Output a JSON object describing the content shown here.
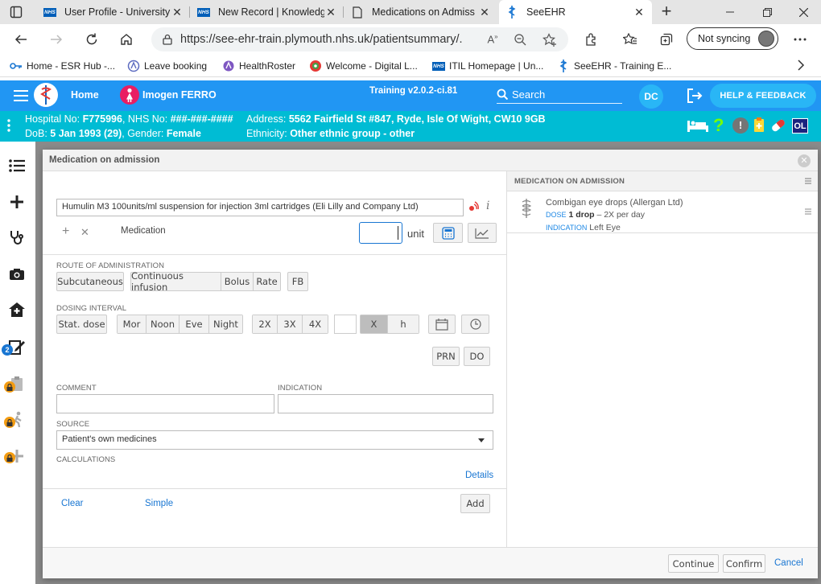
{
  "browser": {
    "tabs": [
      {
        "title": "User Profile - University",
        "icon": "nhs-icon"
      },
      {
        "title": "New Record | Knowledg",
        "icon": "nhs-icon"
      },
      {
        "title": "Medications on Admiss",
        "icon": "document-icon"
      },
      {
        "title": "SeeEHR",
        "icon": "seeehr-icon",
        "active": true
      }
    ],
    "url": "https://see-ehr-train.plymouth.nhs.uk/patientsummary/...",
    "sync_label": "Not syncing",
    "bookmarks": [
      {
        "label": "Home - ESR Hub -...",
        "icon": "key-icon"
      },
      {
        "label": "Leave booking",
        "icon": "roster-icon"
      },
      {
        "label": "HealthRoster",
        "icon": "roster-icon"
      },
      {
        "label": "Welcome - Digital L...",
        "icon": "globe-icon"
      },
      {
        "label": "ITIL Homepage | Un...",
        "icon": "nhs-icon"
      },
      {
        "label": "SeeEHR - Training E...",
        "icon": "seeehr-icon"
      }
    ]
  },
  "app": {
    "home_label": "Home",
    "patient_name": "Imogen FERRO",
    "training_label": "Training v2.0.2-ci.81",
    "search_placeholder": "Search",
    "user_initials": "DC",
    "help_label": "HELP & FEEDBACK",
    "colors": {
      "header": "#2196f3",
      "patient_bar": "#00bcd4",
      "accent": "#29b6f6"
    }
  },
  "patient": {
    "hospital_label": "Hospital No:",
    "hospital_no": "F775996",
    "nhs_label": "NHS No:",
    "nhs_no": "###-###-####",
    "address_label": "Address:",
    "address": "5562 Fairfield St #847, Ryde, Isle Of Wight, CW10 9GB",
    "dob_label": "DoB:",
    "dob": "5 Jan 1993 (29)",
    "gender_label": "Gender:",
    "gender": "Female",
    "ethnicity_label": "Ethnicity:",
    "ethnicity": "Other ethnic group - other",
    "badge_ol": "OL"
  },
  "sidebar": {
    "badge_count": "2"
  },
  "modal": {
    "title": "Medication on admission",
    "medication_field": "Humulin M3 100units/ml suspension for injection 3ml cartridges (Eli Lilly and Company Ltd)",
    "medication_label": "Medication",
    "unit_label": "unit",
    "route_label": "ROUTE OF ADMINISTRATION",
    "route_buttons": [
      "Subcutaneous",
      "Continuous infusion",
      "Bolus",
      "Rate",
      "FB"
    ],
    "dosing_label": "DOSING INTERVAL",
    "stat_dose": "Stat. dose",
    "times": [
      "Mor",
      "Noon",
      "Eve",
      "Night"
    ],
    "frequencies": [
      "2X",
      "3X",
      "4X"
    ],
    "x_label": "X",
    "h_label": "h",
    "prn": "PRN",
    "do": "DO",
    "comment_label": "COMMENT",
    "indication_label": "INDICATION",
    "source_label": "SOURCE",
    "source_value": "Patient's own medicines",
    "calculations_label": "CALCULATIONS",
    "details_link": "Details",
    "clear_link": "Clear",
    "simple_link": "Simple",
    "add_button": "Add",
    "continue_button": "Continue",
    "confirm_button": "Confirm",
    "cancel_link": "Cancel"
  },
  "admission_panel": {
    "header": "MEDICATION ON ADMISSION",
    "items": [
      {
        "name": "Combigan eye drops (Allergan Ltd)",
        "dose_label": "DOSE",
        "dose_value": "1 drop",
        "dose_freq": "– 2X per day",
        "indication_label": "INDICATION",
        "indication_value": "Left Eye"
      }
    ]
  }
}
